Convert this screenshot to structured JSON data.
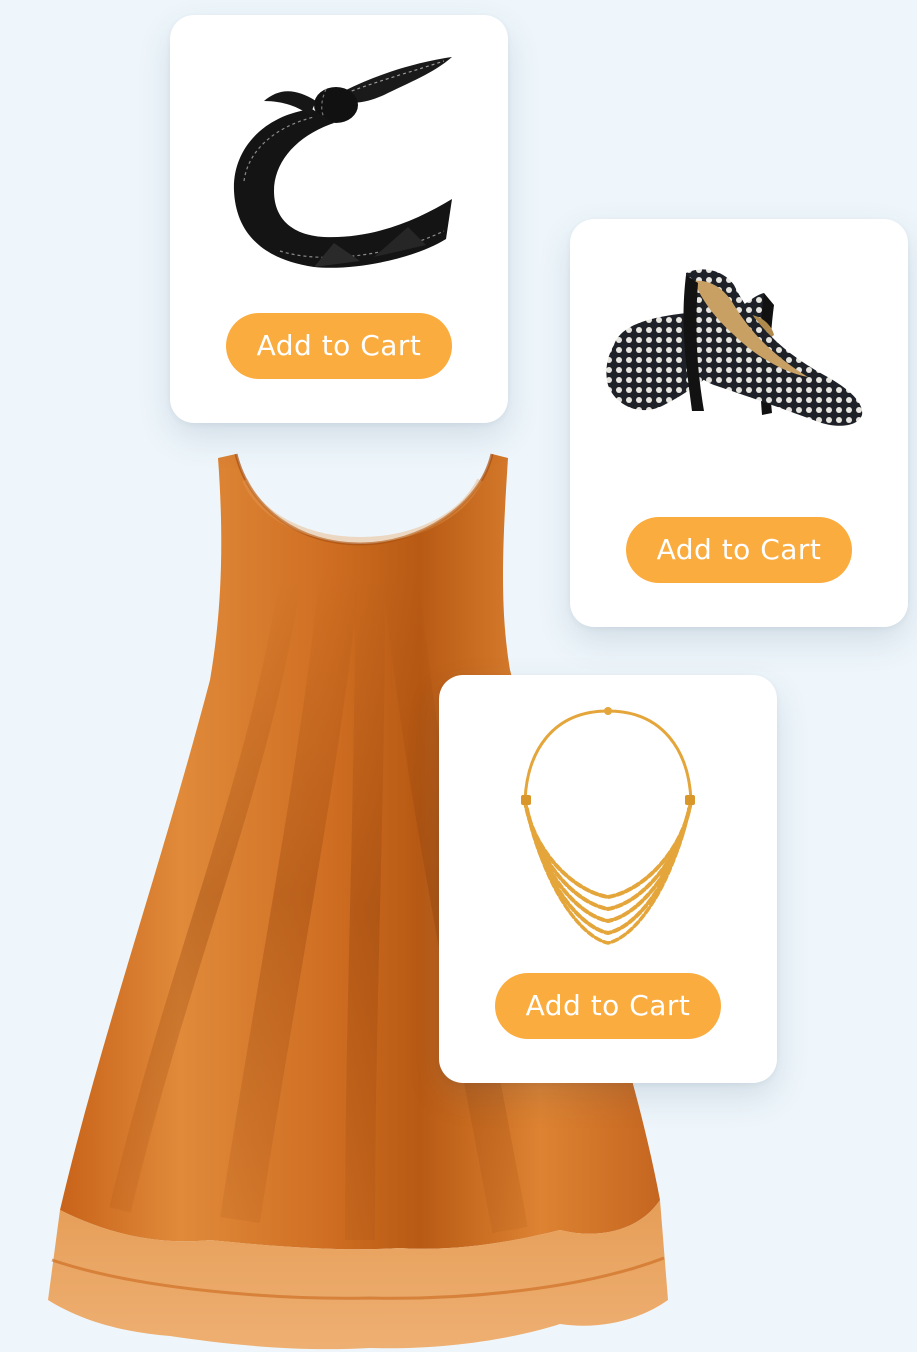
{
  "theme": {
    "background": "#eef6fb",
    "button_color": "#fbac3f",
    "button_text_color": "#ffffff",
    "dress_color": "#d9782a"
  },
  "main_product": {
    "icon": "orange-dress-image"
  },
  "products": [
    {
      "icon": "black-bandana-scarf-image",
      "button_label": "Add to Cart"
    },
    {
      "icon": "polka-dot-high-heel-shoes-image",
      "button_label": "Add to Cart"
    },
    {
      "icon": "gold-layered-necklace-image",
      "button_label": "Add to Cart"
    }
  ]
}
